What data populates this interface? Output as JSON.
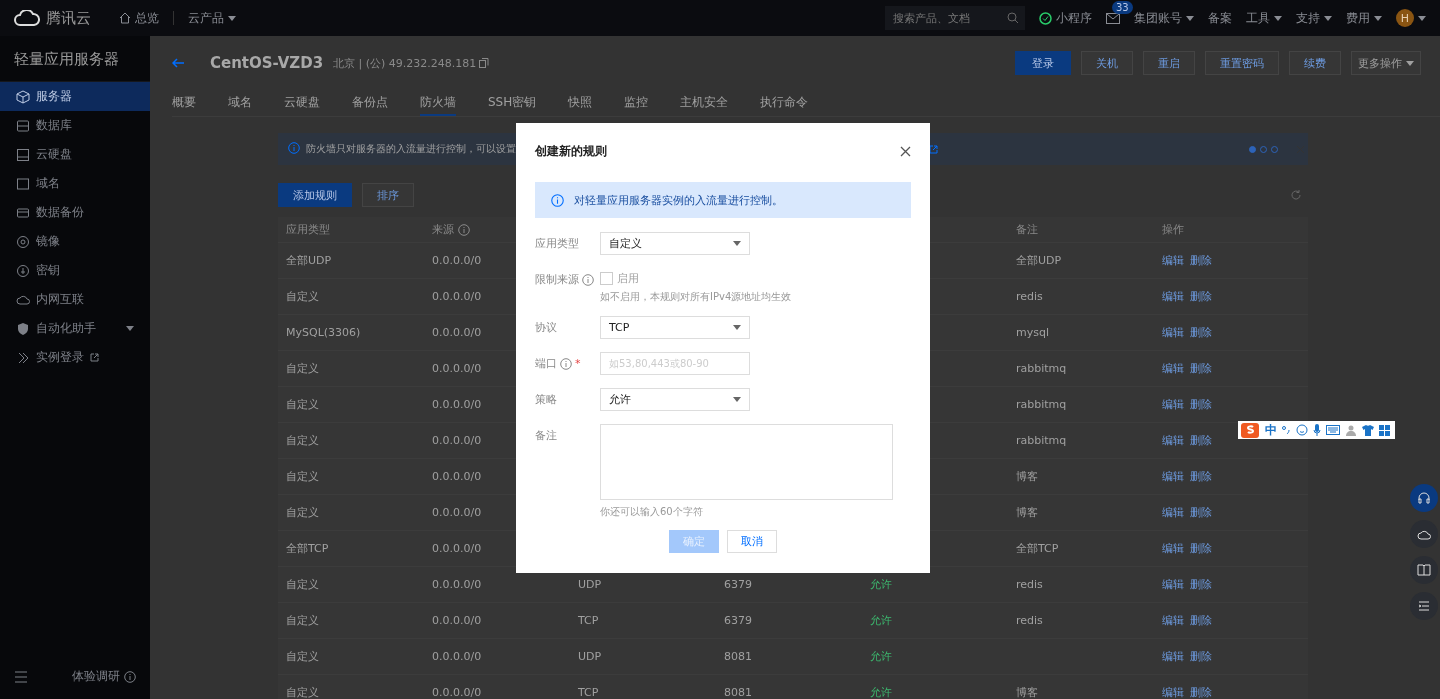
{
  "top_nav": {
    "brand": "腾讯云",
    "overview": "总览",
    "products": "云产品",
    "search": {
      "placeholder": "搜索产品、文档"
    },
    "mini_program": "小程序",
    "mail_badge": "33",
    "links": [
      {
        "label": "集团账号",
        "dropdown": true
      },
      {
        "label": "备案",
        "dropdown": false
      },
      {
        "label": "工具",
        "dropdown": true
      },
      {
        "label": "支持",
        "dropdown": true
      },
      {
        "label": "费用",
        "dropdown": true
      }
    ],
    "avatar": "H"
  },
  "sidebar": {
    "title": "轻量应用服务器",
    "items": [
      {
        "label": "服务器",
        "selected": true
      },
      {
        "label": "数据库",
        "selected": false
      },
      {
        "label": "云硬盘",
        "selected": false
      },
      {
        "label": "域名",
        "selected": false
      },
      {
        "label": "数据备份",
        "selected": false
      },
      {
        "label": "镜像",
        "selected": false
      },
      {
        "label": "密钥",
        "selected": false
      },
      {
        "label": "内网互联",
        "selected": false
      },
      {
        "label": "自动化助手",
        "selected": false,
        "expandable": true
      },
      {
        "label": "实例登录",
        "selected": false,
        "external": true
      }
    ],
    "survey": "体验调研"
  },
  "instance": {
    "name": "CentOS-VZD3",
    "address": "北京 | (公) 49.232.248.181"
  },
  "actions": [
    {
      "label": "登录",
      "primary": true,
      "dropdown": false
    },
    {
      "label": "关机",
      "primary": false,
      "dropdown": false
    },
    {
      "label": "重启",
      "primary": false,
      "dropdown": false
    },
    {
      "label": "重置密码",
      "primary": false,
      "dropdown": false
    },
    {
      "label": "续费",
      "primary": false,
      "dropdown": false
    },
    {
      "label": "更多操作",
      "primary": false,
      "dropdown": true
    }
  ],
  "tabs": [
    {
      "label": "概要",
      "selected": false
    },
    {
      "label": "域名",
      "selected": false
    },
    {
      "label": "云硬盘",
      "selected": false
    },
    {
      "label": "备份点",
      "selected": false
    },
    {
      "label": "防火墙",
      "selected": true
    },
    {
      "label": "SSH密钥",
      "selected": false
    },
    {
      "label": "快照",
      "selected": false
    },
    {
      "label": "监控",
      "selected": false
    },
    {
      "label": "主机安全",
      "selected": false
    },
    {
      "label": "执行命令",
      "selected": false
    }
  ],
  "notice": {
    "text": "防火墙只对服务器的入流量进行控制，可以设置",
    "dots": [
      {
        "selected": true
      },
      {
        "selected": false
      },
      {
        "selected": false
      }
    ]
  },
  "toolbar": {
    "add": "添加规则",
    "sort": "排序"
  },
  "table": {
    "columns": [
      {
        "label": "应用类型"
      },
      {
        "label": "来源",
        "info": true
      },
      {},
      {},
      {},
      {
        "label": "备注"
      },
      {
        "label": "操作"
      }
    ],
    "rows": [
      {
        "type": "全部UDP",
        "source": "0.0.0.0/0",
        "note": "全部UDP",
        "actions": [
          "编辑",
          "删除"
        ]
      },
      {
        "type": "自定义",
        "source": "0.0.0.0/0",
        "note": "redis",
        "actions": [
          "编辑",
          "删除"
        ]
      },
      {
        "type": "MySQL(3306)",
        "source": "0.0.0.0/0",
        "note": "mysql",
        "actions": [
          "编辑",
          "删除"
        ]
      },
      {
        "type": "自定义",
        "source": "0.0.0.0/0",
        "note": "rabbitmq",
        "actions": [
          "编辑",
          "删除"
        ]
      },
      {
        "type": "自定义",
        "source": "0.0.0.0/0",
        "note": "rabbitmq",
        "actions": [
          "编辑",
          "删除"
        ]
      },
      {
        "type": "自定义",
        "source": "0.0.0.0/0",
        "note": "rabbitmq",
        "actions": [
          "编辑",
          "删除"
        ]
      },
      {
        "type": "自定义",
        "source": "0.0.0.0/0",
        "note": "博客",
        "actions": [
          "编辑",
          "删除"
        ]
      },
      {
        "type": "自定义",
        "source": "0.0.0.0/0",
        "note": "博客",
        "actions": [
          "编辑",
          "删除"
        ]
      },
      {
        "type": "全部TCP",
        "source": "0.0.0.0/0",
        "note": "全部TCP",
        "actions": [
          "编辑",
          "删除"
        ]
      },
      {
        "type": "自定义",
        "source": "0.0.0.0/0",
        "protocol": "UDP",
        "port": "6379",
        "policy": "允许",
        "note": "redis",
        "actions": [
          "编辑",
          "删除"
        ]
      },
      {
        "type": "自定义",
        "source": "0.0.0.0/0",
        "protocol": "TCP",
        "port": "6379",
        "policy": "允许",
        "note": "redis",
        "actions": [
          "编辑",
          "删除"
        ]
      },
      {
        "type": "自定义",
        "source": "0.0.0.0/0",
        "protocol": "UDP",
        "port": "8081",
        "policy": "允许",
        "actions": [
          "编辑",
          "删除"
        ]
      },
      {
        "type": "自定义",
        "source": "0.0.0.0/0",
        "protocol": "TCP",
        "port": "8081",
        "policy": "允许",
        "note": "博客",
        "actions": [
          "编辑",
          "删除"
        ]
      }
    ]
  },
  "ime_toolbar": {
    "mode": "中"
  },
  "dialog": {
    "title": "创建新的规则",
    "info": "对轻量应用服务器实例的入流量进行控制。",
    "fields": [
      {
        "kind": "select",
        "label": "应用类型",
        "value": "自定义"
      },
      {
        "kind": "checkbox",
        "label": "限制来源",
        "info": true,
        "option": "启用",
        "checked": false,
        "hint": "如不启用，本规则对所有IPv4源地址均生效"
      },
      {
        "kind": "select",
        "label": "协议",
        "value": "TCP"
      },
      {
        "kind": "input",
        "label": "端口",
        "info": true,
        "required_mark": "*",
        "placeholder": "如53,80,443或80-90"
      },
      {
        "kind": "select",
        "label": "策略",
        "value": "允许"
      },
      {
        "kind": "textarea",
        "label": "备注",
        "hint": "你还可以输入60个字符"
      }
    ],
    "confirm": {
      "label": "确定",
      "disabled": true
    },
    "cancel": "取消"
  }
}
